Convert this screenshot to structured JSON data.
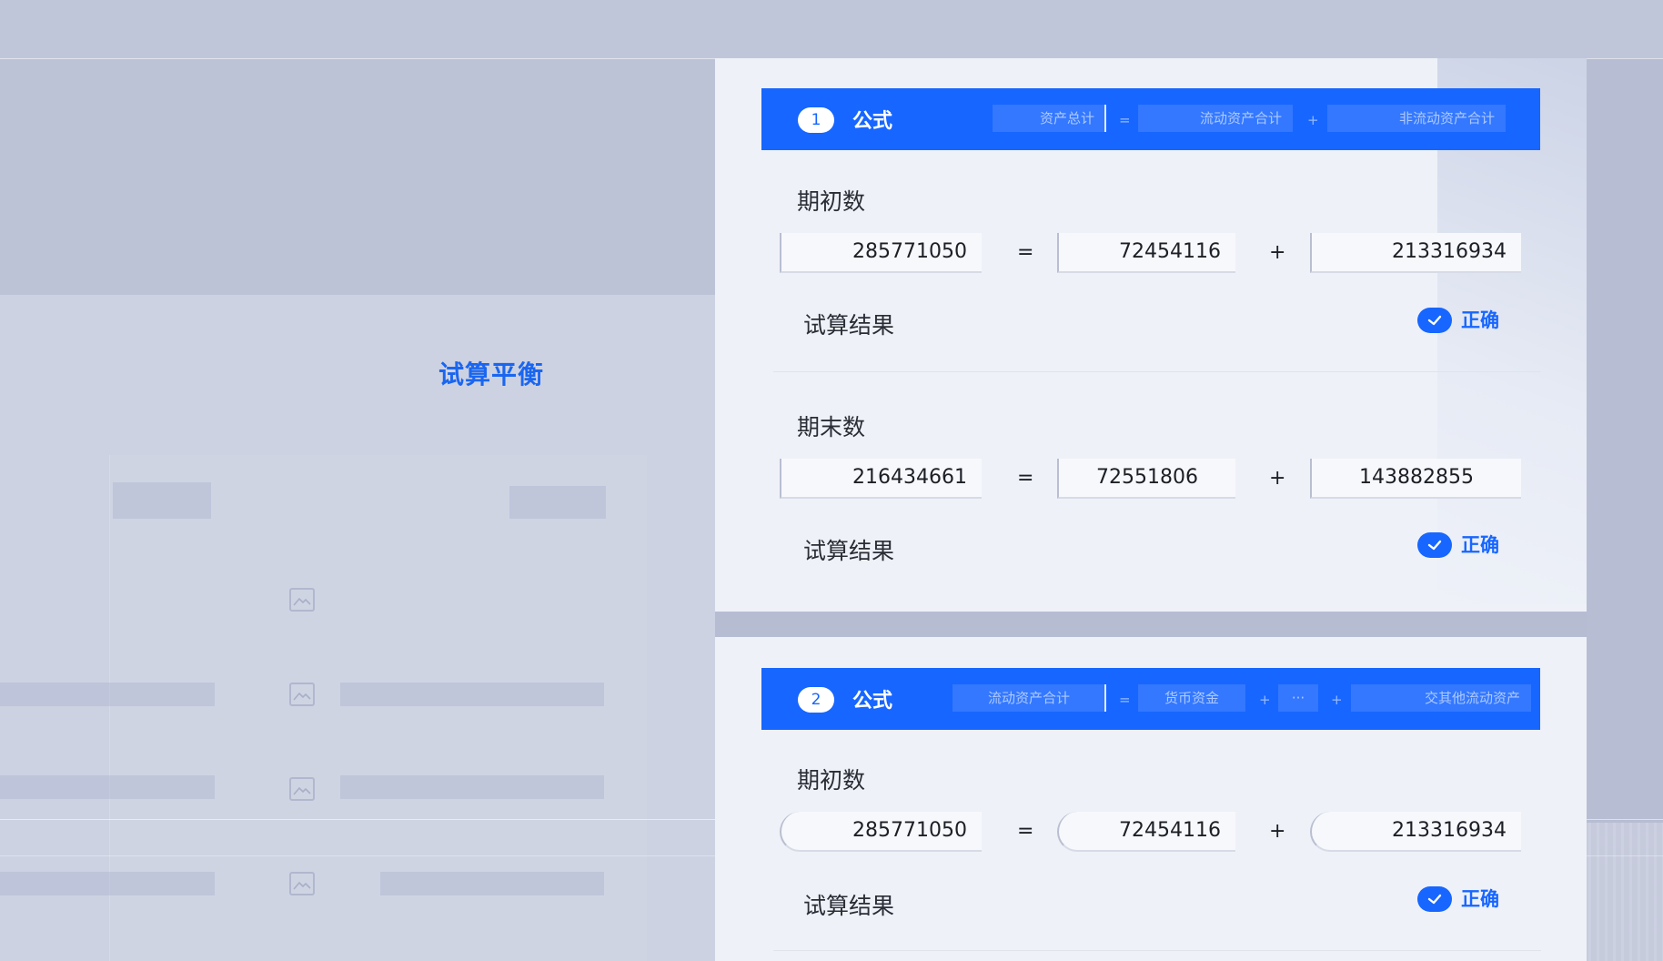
{
  "sidebar": {
    "title": "试算平衡"
  },
  "formulas": [
    {
      "step": "1",
      "label": "公式",
      "terms": [
        "资产总计",
        "流动资产合计",
        "非流动资产合计"
      ],
      "ops": [
        "=",
        "+"
      ],
      "sections": [
        {
          "label": "期初数",
          "values": [
            "285771050",
            "72454116",
            "213316934"
          ],
          "ops": [
            "=",
            "+"
          ],
          "result_label": "试算结果",
          "status": "正确"
        },
        {
          "label": "期末数",
          "values": [
            "216434661",
            "72551806",
            "143882855"
          ],
          "ops": [
            "=",
            "+"
          ],
          "result_label": "试算结果",
          "status": "正确"
        }
      ]
    },
    {
      "step": "2",
      "label": "公式",
      "terms": [
        "流动资产合计",
        "货币资金",
        "···",
        "交其他流动资产"
      ],
      "ops": [
        "=",
        "+",
        "+"
      ],
      "sections": [
        {
          "label": "期初数",
          "values": [
            "285771050",
            "72454116",
            "213316934"
          ],
          "ops": [
            "=",
            "+"
          ],
          "result_label": "试算结果",
          "status": "正确"
        }
      ]
    }
  ],
  "colors": {
    "accent": "#1766ff",
    "card": "#eef1f8",
    "background": "#c4cadc"
  },
  "icons": {
    "status": "check-icon",
    "placeholder": "image-icon"
  }
}
